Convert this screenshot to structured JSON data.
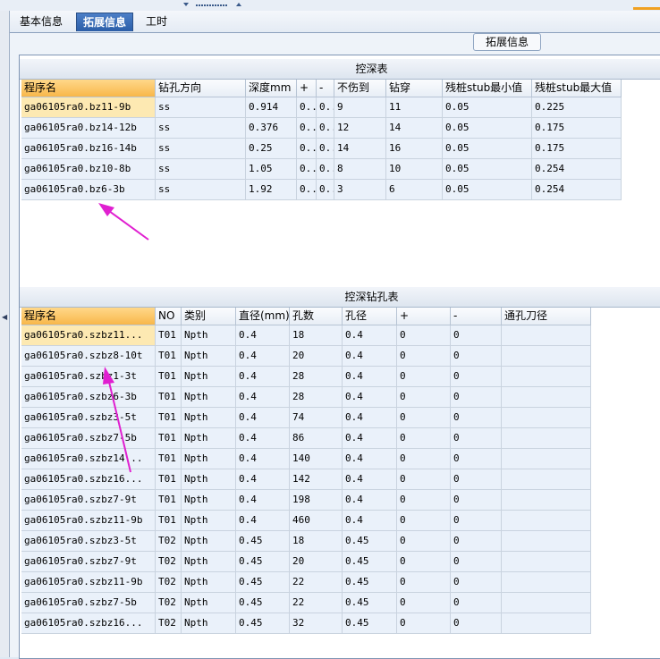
{
  "tabs": [
    {
      "label": "基本信息",
      "active": false
    },
    {
      "label": "拓展信息",
      "active": true
    },
    {
      "label": "工时",
      "active": false
    }
  ],
  "panel_caption": "拓展信息",
  "table1": {
    "title": "控深表",
    "columns": [
      "程序名",
      "钻孔方向",
      "深度mm",
      "+",
      "-",
      "不伤到",
      "钻穿",
      "残桩stub最小值",
      "残桩stub最大值"
    ],
    "rows": [
      [
        "ga06105ra0.bz11-9b",
        "ss",
        "0.914",
        "0..",
        "0..",
        "9",
        "11",
        "0.05",
        "0.225"
      ],
      [
        "ga06105ra0.bz14-12b",
        "ss",
        "0.376",
        "0..",
        "0..",
        "12",
        "14",
        "0.05",
        "0.175"
      ],
      [
        "ga06105ra0.bz16-14b",
        "ss",
        "0.25",
        "0..",
        "0..",
        "14",
        "16",
        "0.05",
        "0.175"
      ],
      [
        "ga06105ra0.bz10-8b",
        "ss",
        "1.05",
        "0..",
        "0..",
        "8",
        "10",
        "0.05",
        "0.254"
      ],
      [
        "ga06105ra0.bz6-3b",
        "ss",
        "1.92",
        "0..",
        "0..",
        "3",
        "6",
        "0.05",
        "0.254"
      ]
    ]
  },
  "table2": {
    "title": "控深钻孔表",
    "columns": [
      "程序名",
      "NO",
      "类别",
      "直径(mm)",
      "孔数",
      "孔径",
      "+",
      "-",
      "通孔刀径"
    ],
    "rows": [
      [
        "ga06105ra0.szbz11...",
        "T01",
        "Npth",
        "0.4",
        "18",
        "0.4",
        "0",
        "0",
        ""
      ],
      [
        "ga06105ra0.szbz8-10t",
        "T01",
        "Npth",
        "0.4",
        "20",
        "0.4",
        "0",
        "0",
        ""
      ],
      [
        "ga06105ra0.szbz1-3t",
        "T01",
        "Npth",
        "0.4",
        "28",
        "0.4",
        "0",
        "0",
        ""
      ],
      [
        "ga06105ra0.szbz6-3b",
        "T01",
        "Npth",
        "0.4",
        "28",
        "0.4",
        "0",
        "0",
        ""
      ],
      [
        "ga06105ra0.szbz3-5t",
        "T01",
        "Npth",
        "0.4",
        "74",
        "0.4",
        "0",
        "0",
        ""
      ],
      [
        "ga06105ra0.szbz7-5b",
        "T01",
        "Npth",
        "0.4",
        "86",
        "0.4",
        "0",
        "0",
        ""
      ],
      [
        "ga06105ra0.szbz14...",
        "T01",
        "Npth",
        "0.4",
        "140",
        "0.4",
        "0",
        "0",
        ""
      ],
      [
        "ga06105ra0.szbz16...",
        "T01",
        "Npth",
        "0.4",
        "142",
        "0.4",
        "0",
        "0",
        ""
      ],
      [
        "ga06105ra0.szbz7-9t",
        "T01",
        "Npth",
        "0.4",
        "198",
        "0.4",
        "0",
        "0",
        ""
      ],
      [
        "ga06105ra0.szbz11-9b",
        "T01",
        "Npth",
        "0.4",
        "460",
        "0.4",
        "0",
        "0",
        ""
      ],
      [
        "ga06105ra0.szbz3-5t",
        "T02",
        "Npth",
        "0.45",
        "18",
        "0.45",
        "0",
        "0",
        ""
      ],
      [
        "ga06105ra0.szbz7-9t",
        "T02",
        "Npth",
        "0.45",
        "20",
        "0.45",
        "0",
        "0",
        ""
      ],
      [
        "ga06105ra0.szbz11-9b",
        "T02",
        "Npth",
        "0.45",
        "22",
        "0.45",
        "0",
        "0",
        ""
      ],
      [
        "ga06105ra0.szbz7-5b",
        "T02",
        "Npth",
        "0.45",
        "22",
        "0.45",
        "0",
        "0",
        ""
      ],
      [
        "ga06105ra0.szbz16...",
        "T02",
        "Npth",
        "0.45",
        "32",
        "0.45",
        "0",
        "0",
        ""
      ]
    ]
  },
  "annotation_color": "#e020d0"
}
